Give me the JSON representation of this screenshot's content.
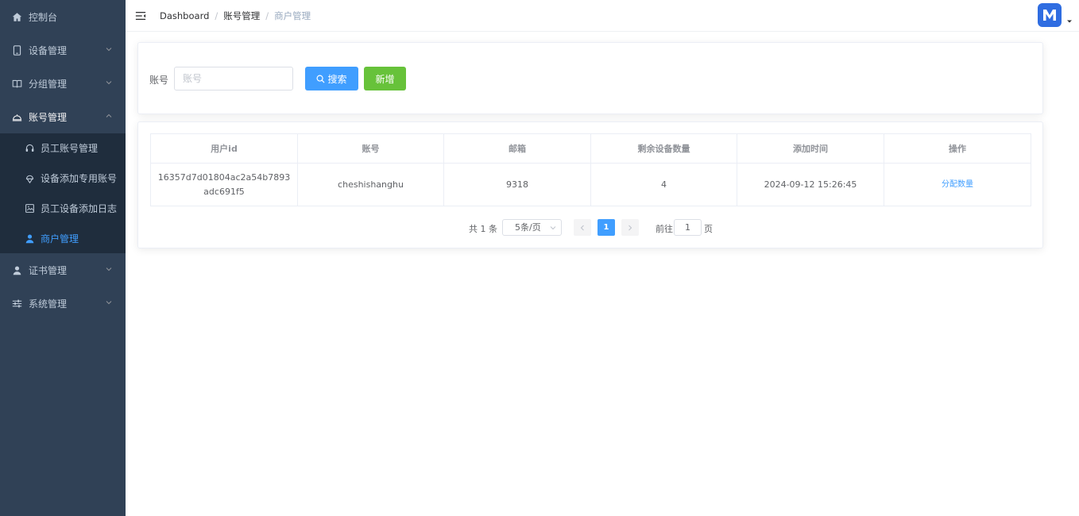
{
  "sidebar": {
    "items": [
      {
        "label": "控制台",
        "icon": "home-icon"
      },
      {
        "label": "设备管理",
        "icon": "tablet-icon"
      },
      {
        "label": "分组管理",
        "icon": "book-icon"
      },
      {
        "label": "账号管理",
        "icon": "cloche-icon"
      },
      {
        "label": "证书管理",
        "icon": "user-icon"
      },
      {
        "label": "系统管理",
        "icon": "sliders-icon"
      }
    ],
    "account_submenu": [
      {
        "label": "员工账号管理",
        "icon": "headset-icon"
      },
      {
        "label": "设备添加专用账号",
        "icon": "ice-cream-icon"
      },
      {
        "label": "员工设备添加日志",
        "icon": "picture-icon"
      },
      {
        "label": "商户管理",
        "icon": "user-solid-icon"
      }
    ]
  },
  "header": {
    "breadcrumb": [
      "Dashboard",
      "账号管理",
      "商户管理"
    ]
  },
  "search": {
    "label": "账号",
    "placeholder": "账号",
    "value": "",
    "search_button": "搜索",
    "add_button": "新增"
  },
  "table": {
    "columns": [
      "用户id",
      "账号",
      "邮箱",
      "剩余设备数量",
      "添加时间",
      "操作"
    ],
    "rows": [
      {
        "user_id": "16357d7d01804ac2a54b7893adc691f5",
        "account": "cheshishanghu",
        "email": "9318",
        "remaining_devices": "4",
        "added_time": "2024-09-12 15:26:45",
        "action": "分配数量"
      }
    ]
  },
  "pagination": {
    "total": "共 1 条",
    "page_size": "5条/页",
    "current_page": "1",
    "goto_label": "前往",
    "goto_value": "1",
    "goto_unit": "页"
  },
  "colors": {
    "sidebar_bg": "#304156",
    "submenu_bg": "#1f2d3d",
    "primary": "#409eff",
    "success": "#67c23a",
    "avatar": "#2f6de1"
  }
}
